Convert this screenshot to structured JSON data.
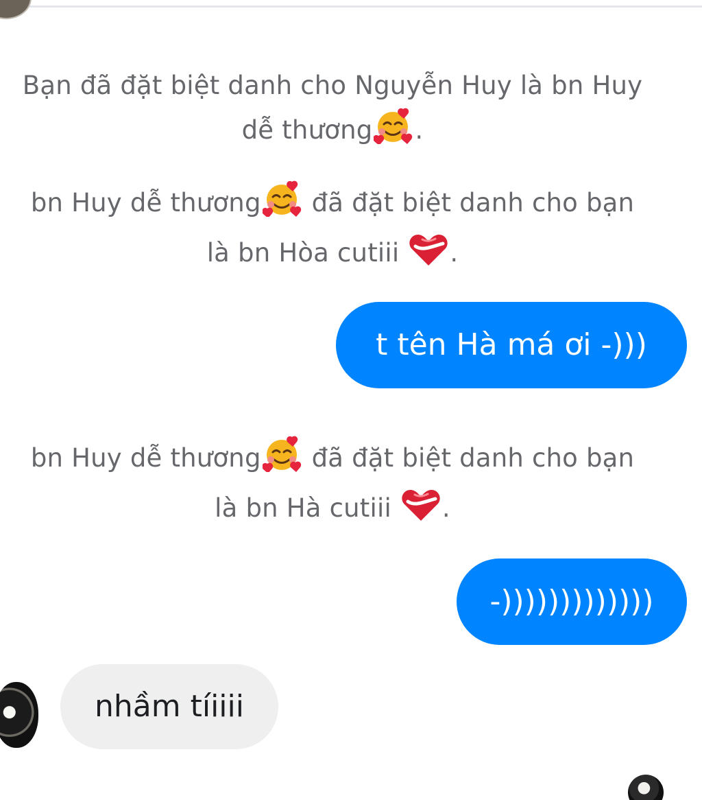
{
  "messages": {
    "system_1": {
      "before_emoji": "Bạn đã đặt biệt danh cho Nguyễn Huy là bn Huy",
      "line_2_prefix": "dễ thương",
      "emoji": "smiling-face-with-hearts-emoji",
      "suffix": "."
    },
    "system_2": {
      "line_1_prefix": "bn Huy dễ thương",
      "emoji_1": "smiling-face-with-hearts-emoji",
      "line_1_suffix": " đã đặt biệt danh cho bạn",
      "line_2_prefix": "là bn Hòa cutiii ",
      "emoji_2": "heart-emoji",
      "suffix": "."
    },
    "outgoing_1": {
      "text": "t tên Hà má ơi -)))"
    },
    "system_3": {
      "line_1_prefix": "bn Huy dễ thương",
      "emoji_1": "smiling-face-with-hearts-emoji",
      "line_1_suffix": " đã đặt biệt danh cho bạn",
      "line_2_prefix": "là bn Hà cutiii ",
      "emoji_2": "heart-emoji",
      "suffix": "."
    },
    "outgoing_2": {
      "text": "-)))))))))))))"
    },
    "incoming_1": {
      "text": "nhầm tíiiii"
    }
  },
  "icons": {
    "smiling_face_with_hearts": "smiling-face-with-hearts-emoji",
    "heart": "heart-emoji",
    "avatar_left": "avatar",
    "read_receipt_avatar": "read-receipt-avatar"
  },
  "colors": {
    "outgoing_bubble": "#0084ff",
    "incoming_bubble": "#efefef",
    "system_text": "#65676b",
    "background": "#ffffff"
  }
}
